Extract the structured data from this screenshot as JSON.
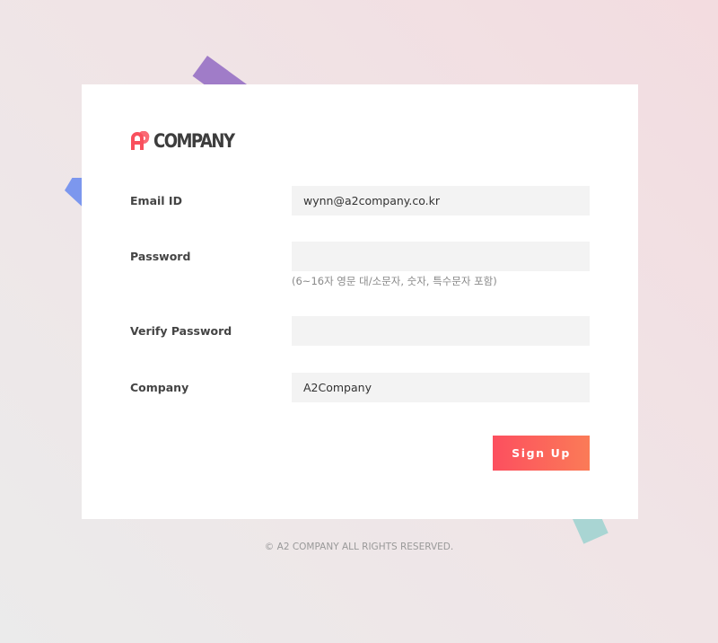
{
  "brand": {
    "logo_text": "COMPANY",
    "logo_mark_text": "A2",
    "accent_color": "#f9505d"
  },
  "form": {
    "email": {
      "label": "Email ID",
      "value": "wynn@a2company.co.kr",
      "placeholder": ""
    },
    "password": {
      "label": "Password",
      "value": "",
      "placeholder": "",
      "hint": "(6~16자 영문 대/소문자, 숫자, 특수문자 포함)"
    },
    "verify_password": {
      "label": "Verify Password",
      "value": "",
      "placeholder": ""
    },
    "company": {
      "label": "Company",
      "value": "A2Company",
      "placeholder": ""
    },
    "submit_label": "Sign Up",
    "submit_gradient": [
      "#fc4f5f",
      "#fb7b57"
    ]
  },
  "footer": {
    "copyright": "© A2 COMPANY ALL RIGHTS RESERVED."
  },
  "decor_colors": {
    "purple": "#a07cc8",
    "blue": "#7c97ee",
    "teal": "#a9d5d3"
  }
}
